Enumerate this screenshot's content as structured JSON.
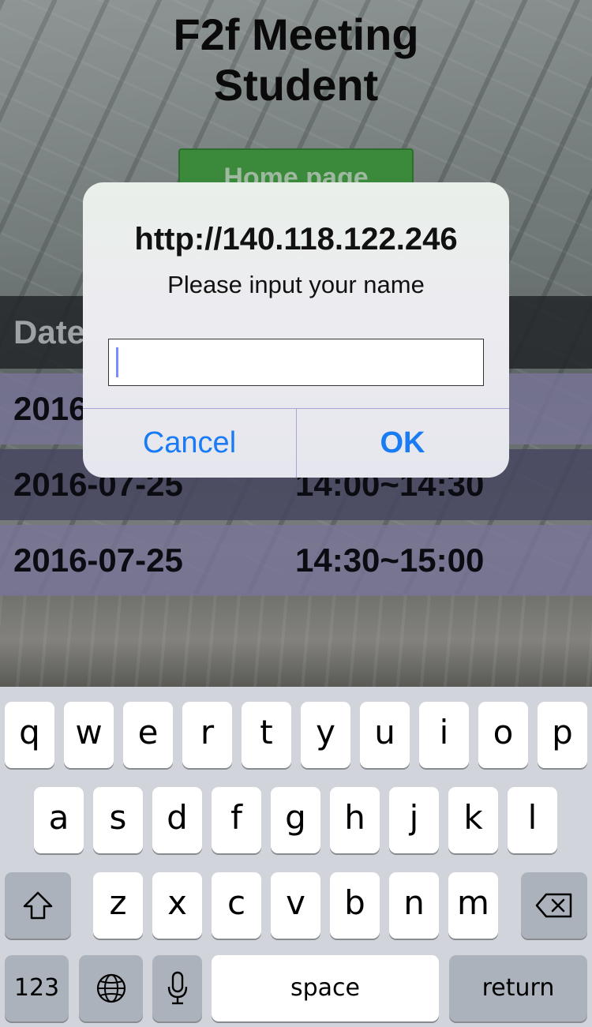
{
  "page": {
    "title_line1": "F2f Meeting",
    "title_line2": "Student",
    "home_button_label": "Home page"
  },
  "table": {
    "header_label": "Date",
    "rows": [
      {
        "date": "2016",
        "time": ""
      },
      {
        "date": "2016-07-25",
        "time": "14:00~14:30"
      },
      {
        "date": "2016-07-25",
        "time": "14:30~15:00"
      }
    ]
  },
  "dialog": {
    "title": "http://140.118.122.246",
    "message": "Please input your name",
    "input_value": "",
    "cancel_label": "Cancel",
    "ok_label": "OK"
  },
  "keyboard": {
    "row1": [
      "q",
      "w",
      "e",
      "r",
      "t",
      "y",
      "u",
      "i",
      "o",
      "p"
    ],
    "row2": [
      "a",
      "s",
      "d",
      "f",
      "g",
      "h",
      "j",
      "k",
      "l"
    ],
    "row3": [
      "z",
      "x",
      "c",
      "v",
      "b",
      "n",
      "m"
    ],
    "numbers_label": "123",
    "space_label": "space",
    "return_label": "return",
    "icons": {
      "shift": "shift-icon",
      "delete": "delete-icon",
      "globe": "globe-icon",
      "mic": "microphone-icon"
    }
  },
  "colors": {
    "dialog_button": "#1a7cf5",
    "home_button": "#3b8a3b",
    "row_fill": "#7874a0"
  }
}
